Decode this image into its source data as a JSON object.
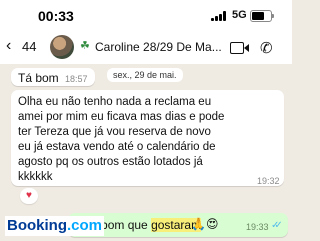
{
  "status_bar": {
    "time": "00:33",
    "network": "5G"
  },
  "header": {
    "back_count": "44",
    "contact_name": "Caroline 28/29 De Ma..."
  },
  "messages": [
    {
      "text": "Tá bom",
      "time": "18:57"
    },
    {
      "lines": [
        "Olha eu não tenho nada a reclama eu",
        "amei por mim eu ficava mas dias e pode",
        "ter Tereza que já vou reserva de novo",
        "eu já estava vendo até o calendário de",
        "agosto pq os outros estão lotados já",
        "kkkkkk"
      ],
      "time": "19:32",
      "reaction": "♥"
    },
    {
      "before": "Que bom que ",
      "highlight": "gostaram",
      "emoji": "🙏😍",
      "time": "19:33"
    }
  ],
  "date_chip": "sex., 29 de mai.",
  "watermark": {
    "brand": "Booking",
    "tld": ".com"
  }
}
